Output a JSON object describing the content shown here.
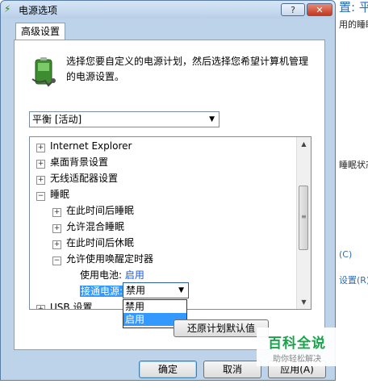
{
  "background": {
    "top_title": "置: 平",
    "line1": "用的睡眠",
    "line2": "睡眠状态",
    "line3": "(C)",
    "line4": "设置(R)"
  },
  "window": {
    "title": "电源选项",
    "help_label": "?",
    "close_label": "✕"
  },
  "tab": {
    "label": "高级设置"
  },
  "description": "选择您要自定义的电源计划，然后选择您希望计算机管理的电源设置。",
  "plan_select": {
    "value": "平衡 [活动]"
  },
  "tree": {
    "items": [
      {
        "label": "Internet Explorer",
        "expander": "+"
      },
      {
        "label": "桌面背景设置",
        "expander": "+"
      },
      {
        "label": "无线适配器设置",
        "expander": "+"
      },
      {
        "label": "睡眠",
        "expander": "−"
      },
      {
        "label": "在此时间后睡眠",
        "expander": "+"
      },
      {
        "label": "允许混合睡眠",
        "expander": "+"
      },
      {
        "label": "在此时间后休眠",
        "expander": "+"
      },
      {
        "label": "允许使用唤醒定时器",
        "expander": "−"
      },
      {
        "label": "USB 设置",
        "expander": "+"
      }
    ],
    "battery_label": "使用电池:",
    "battery_value": "启用",
    "plugged_label": "接通电源:",
    "plugged_value": "禁用",
    "dropdown_options": [
      "禁用",
      "启用"
    ]
  },
  "buttons": {
    "restore": "还原计划默认值",
    "ok": "确定",
    "cancel": "取消",
    "apply": "应用(A)"
  },
  "watermark": {
    "main": "百科全说",
    "sub": "助你轻松解决"
  }
}
